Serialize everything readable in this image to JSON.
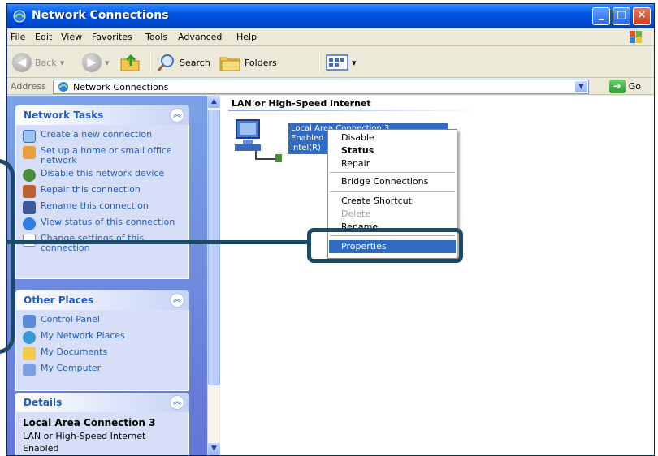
{
  "window": {
    "title": "Network Connections"
  },
  "menubar": [
    "File",
    "Edit",
    "View",
    "Favorites",
    "Tools",
    "Advanced",
    "Help"
  ],
  "toolbar": {
    "back": "Back",
    "search": "Search",
    "folders": "Folders"
  },
  "address": {
    "label": "Address",
    "value": "Network Connections",
    "go": "Go"
  },
  "network_tasks": {
    "title": "Network Tasks",
    "items": [
      {
        "label": "Create a new connection",
        "icon": "new-connection-icon"
      },
      {
        "label": "Set up a home or small office network",
        "icon": "home-network-icon"
      },
      {
        "label": "Disable this network device",
        "icon": "disable-device-icon"
      },
      {
        "label": "Repair this connection",
        "icon": "repair-icon"
      },
      {
        "label": "Rename this connection",
        "icon": "rename-icon"
      },
      {
        "label": "View status of this connection",
        "icon": "status-icon"
      },
      {
        "label": "Change settings of this connection",
        "icon": "settings-icon"
      }
    ]
  },
  "other_places": {
    "title": "Other Places",
    "items": [
      {
        "label": "Control Panel",
        "icon": "control-panel-icon"
      },
      {
        "label": "My Network Places",
        "icon": "network-places-icon"
      },
      {
        "label": "My Documents",
        "icon": "documents-icon"
      },
      {
        "label": "My Computer",
        "icon": "computer-icon"
      }
    ]
  },
  "details": {
    "title": "Details",
    "name": "Local Area Connection 3",
    "line1": "LAN or High-Speed Internet",
    "line2": "Enabled"
  },
  "content": {
    "group_header": "LAN or High-Speed Internet",
    "item_lines": [
      "Local Area Connection 3",
      "Enabled",
      "Intel(R)"
    ]
  },
  "context_menu": {
    "disable": "Disable",
    "status": "Status",
    "repair": "Repair",
    "bridge": "Bridge Connections",
    "shortcut": "Create Shortcut",
    "delete": "Delete",
    "rename": "Rename",
    "properties": "Properties"
  },
  "colors": {
    "callout": "#1c4a64",
    "selection": "#316ac5",
    "titlebar": "#0057e8"
  }
}
